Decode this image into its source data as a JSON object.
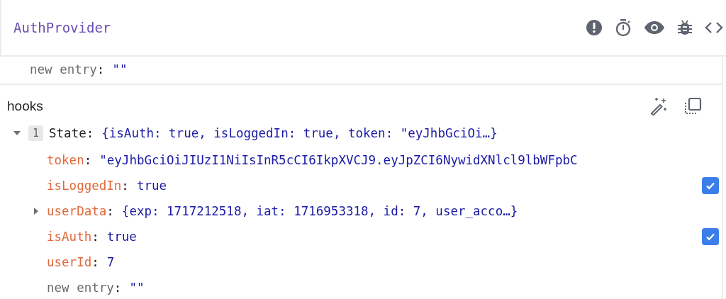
{
  "header": {
    "title": "AuthProvider"
  },
  "props": [
    {
      "key": "new entry",
      "colon": ":",
      "value": "\"\"",
      "kind": "new"
    }
  ],
  "hooks": {
    "title": "hooks",
    "items": [
      {
        "index": "1",
        "name": "State",
        "colon": ":",
        "summary": "{isAuth: true, isLoggedIn: true, token: \"eyJhbGciOi…}",
        "expanded": true,
        "children": [
          {
            "key": "token",
            "colon": ":",
            "value": "\"eyJhbGciOiJIUzI1NiIsInR5cCI6IkpXVCJ9.eyJpZCI6NywidXNlcl9lbWFpbC",
            "kind": "string"
          },
          {
            "key": "isLoggedIn",
            "colon": ":",
            "value": "true",
            "kind": "bool",
            "checked": true
          },
          {
            "key": "userData",
            "colon": ":",
            "value": "{exp: 1717212518, iat: 1716953318, id: 7, user_acco…}",
            "kind": "object",
            "expanded": false
          },
          {
            "key": "isAuth",
            "colon": ":",
            "value": "true",
            "kind": "bool",
            "checked": true
          },
          {
            "key": "userId",
            "colon": ":",
            "value": "7",
            "kind": "number"
          },
          {
            "key": "new entry",
            "colon": ":",
            "value": "\"\"",
            "kind": "new"
          }
        ]
      }
    ]
  }
}
